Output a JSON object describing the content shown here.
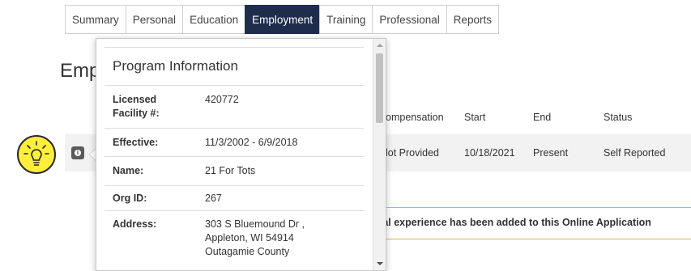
{
  "tabs": [
    {
      "label": "Summary",
      "active": false
    },
    {
      "label": "Personal",
      "active": false
    },
    {
      "label": "Education",
      "active": false
    },
    {
      "label": "Employment",
      "active": true
    },
    {
      "label": "Training",
      "active": false
    },
    {
      "label": "Professional",
      "active": false
    },
    {
      "label": "Reports",
      "active": false
    }
  ],
  "page": {
    "heading_partial": "Emp"
  },
  "table": {
    "headers": {
      "compensation": "ompensation",
      "start": "Start",
      "end": "End",
      "status": "Status"
    },
    "row": {
      "compensation": "lot Provided",
      "start": "10/18/2021",
      "end": "Present",
      "status": "Self Reported"
    }
  },
  "notice": {
    "text": "rial experience has been added to this Online Application"
  },
  "popover": {
    "title": "Program Information",
    "fields": [
      {
        "label": "Licensed Facility #:",
        "value": "420772"
      },
      {
        "label": "Effective:",
        "value": "11/3/2002 - 6/9/2018"
      },
      {
        "label": "Name:",
        "value": "21 For Tots"
      },
      {
        "label": "Org ID:",
        "value": "267"
      },
      {
        "label": "Address:",
        "value": "303 S Bluemound Dr ,\nAppleton, WI 54914\nOutagamie County"
      }
    ]
  },
  "icons": {
    "info": "info-icon",
    "bulb": "lightbulb-icon"
  },
  "colors": {
    "active_tab": "#1f2d4d",
    "notice_border": "#e0b050",
    "bulb_fill": "#ffef3a"
  }
}
